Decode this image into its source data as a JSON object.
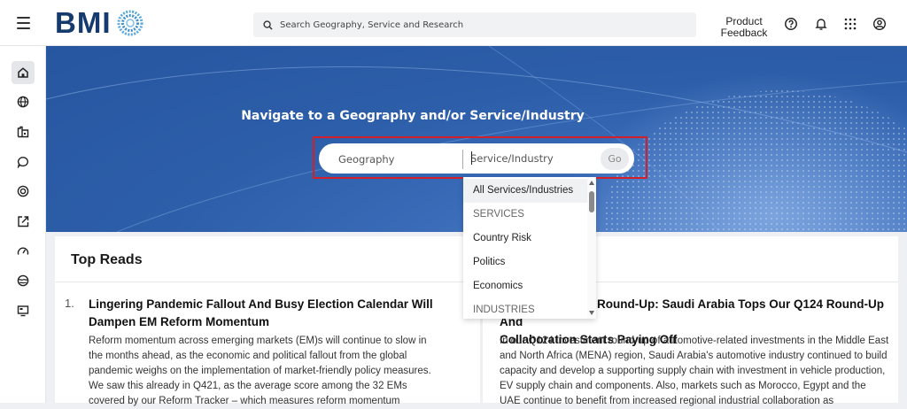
{
  "header": {
    "logo_text": "BMI",
    "search_placeholder": "Search Geography, Service and Research",
    "feedback_line1": "Product",
    "feedback_line2": "Feedback",
    "icons": [
      "help-icon",
      "bell-icon",
      "apps-grid-icon",
      "account-icon"
    ]
  },
  "sidebar": {
    "items": [
      {
        "icon": "home-icon",
        "active": true
      },
      {
        "icon": "globe-icon",
        "active": false
      },
      {
        "icon": "industry-icon",
        "active": false
      },
      {
        "icon": "chat-icon",
        "active": false
      },
      {
        "icon": "target-icon",
        "active": false
      },
      {
        "icon": "export-icon",
        "active": false
      },
      {
        "icon": "gauge-icon",
        "active": false
      },
      {
        "icon": "earth-icon",
        "active": false
      },
      {
        "icon": "monitor-icon",
        "active": false
      }
    ]
  },
  "hero": {
    "title": "Navigate to a Geography and/or Service/Industry",
    "geography_label": "Geography",
    "service_placeholder": "Service/Industry",
    "go_label": "Go"
  },
  "dropdown": {
    "items": [
      {
        "label": "All Services/Industries",
        "type": "option",
        "selected": true
      },
      {
        "label": "SERVICES",
        "type": "header"
      },
      {
        "label": "Country Risk",
        "type": "option"
      },
      {
        "label": "Politics",
        "type": "option"
      },
      {
        "label": "Economics",
        "type": "option"
      },
      {
        "label": "INDUSTRIES",
        "type": "header"
      }
    ]
  },
  "content": {
    "section_title": "Top Reads",
    "articles": [
      {
        "number": "1.",
        "title": "Lingering Pandemic Fallout And Busy Election Calendar Will Dampen EM Reform Momentum",
        "body": "Reform momentum across emerging markets (EM)s will continue to slow in the months ahead, as the economic and political fallout from the global pandemic weighs on the implementation of market-friendly policy measures. We saw this already in Q421, as the average score among the 32 EMs covered by our Reform Tracker – which measures reform momentum"
      },
      {
        "title_part1": "Round-Up: Saudi Arabia Tops Our Q124 Round-Up And",
        "title_part2": "Collaboration Starts Paying Off",
        "body": "In our Q124 investment round-up of automotive-related investments in the Middle East and North Africa (MENA) region, Saudi Arabia's automotive industry continued to build capacity and develop a supporting supply chain with investment in vehicle production, EV supply chain and components. Also, markets such as Morocco, Egypt and the UAE continue to benefit from increased regional industrial collaboration as"
      }
    ]
  },
  "colors": {
    "brand": "#153a6e",
    "hero": "#2d5ea9",
    "highlight": "#d31f2a"
  }
}
